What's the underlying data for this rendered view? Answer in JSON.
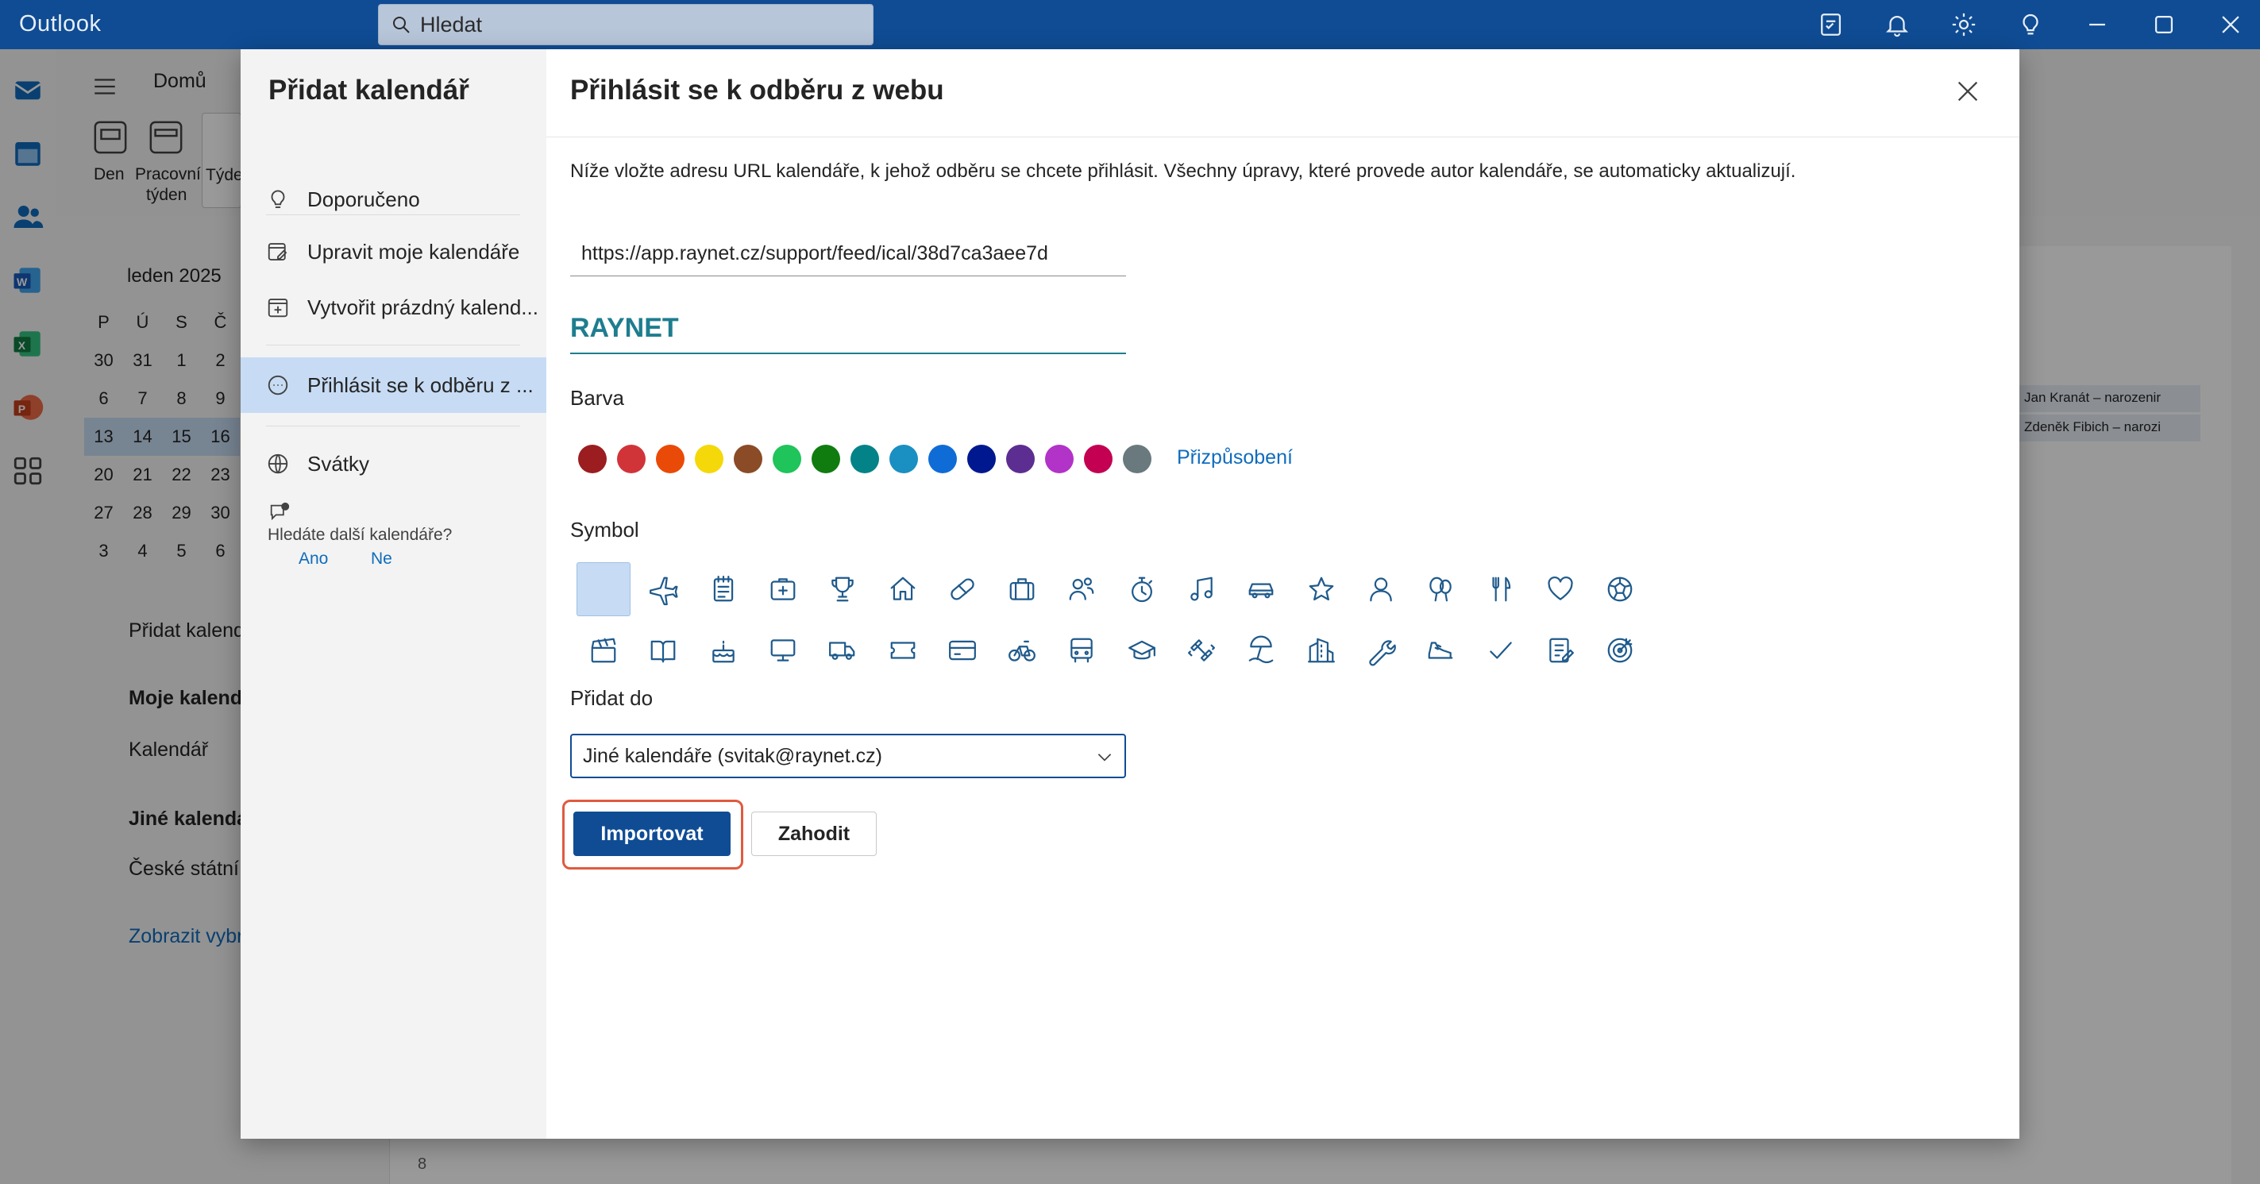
{
  "app": {
    "title": "Outlook"
  },
  "search": {
    "placeholder": "Hledat"
  },
  "ribbon": {
    "home_tab": "Domů",
    "view_day": "Den",
    "view_workweek_line1": "Pracovní",
    "view_workweek_line2": "týden",
    "view_week": "Týde"
  },
  "mini_calendar": {
    "month": "leden 2025",
    "weekdays": [
      "P",
      "Ú",
      "S",
      "Č"
    ],
    "rows": [
      [
        "30",
        "31",
        "1",
        "2"
      ],
      [
        "6",
        "7",
        "8",
        "9"
      ],
      [
        "13",
        "14",
        "15",
        "16"
      ],
      [
        "20",
        "21",
        "22",
        "23"
      ],
      [
        "27",
        "28",
        "29",
        "30"
      ],
      [
        "3",
        "4",
        "5",
        "6"
      ]
    ]
  },
  "left_nav": {
    "add_calendar": "Přidat kalend",
    "my_calendars": "Moje kalend",
    "calendar": "Kalendář",
    "other_calendars": "Jiné kalendá",
    "czech_holidays": "České státní s",
    "show_more": "Zobrazit vybr"
  },
  "calendar_bg": {
    "event1": "Jan Kranát – narozenir",
    "event2": "Zdeněk Fibich – narozi",
    "hour": "8"
  },
  "dialog": {
    "left_title": "Přidat kalendář",
    "nav": [
      {
        "label": "Doporučeno",
        "icon": "lightbulb-icon"
      },
      {
        "label": "Upravit moje kalendáře",
        "icon": "edit-calendar-icon"
      },
      {
        "label": "Vytvořit prázdný kalend...",
        "icon": "add-calendar-icon"
      },
      {
        "label": "Přihlásit se k odběru z ...",
        "icon": "subscribe-icon",
        "active": true
      },
      {
        "label": "Svátky",
        "icon": "globe-icon"
      }
    ],
    "looking_more": "Hledáte další kalendáře?",
    "yes": "Ano",
    "no": "Ne",
    "title": "Přihlásit se k odběru z webu",
    "description": "Níže vložte adresu URL kalendáře, k jehož odběru se chcete přihlásit. Všechny úpravy, které provede autor kalendáře, se automaticky aktualizují.",
    "url_value": "https://app.raynet.cz/support/feed/ical/38d7ca3aee7d",
    "calendar_name": "RAYNET",
    "color_label": "Barva",
    "colors": [
      "#9b1d20",
      "#d13438",
      "#ea4a08",
      "#f5d80a",
      "#8a4b26",
      "#1fc45a",
      "#107c10",
      "#038387",
      "#1a8fc2",
      "#0f6cd6",
      "#00188f",
      "#5c2e91",
      "#b233c7",
      "#c30052",
      "#69797e"
    ],
    "customize": "Přizpůsobení",
    "symbol_label": "Symbol",
    "symbols_row1": [
      "blank",
      "airplane-icon",
      "notepad-icon",
      "first-aid-icon",
      "trophy-icon",
      "home-icon",
      "pill-icon",
      "briefcase-icon",
      "people-icon",
      "stopwatch-icon",
      "music-note-icon",
      "car-icon",
      "star-icon",
      "person-icon",
      "balloon-icon",
      "fork-knife-icon",
      "heart-icon",
      "soccer-ball-icon"
    ],
    "symbols_row2": [
      "movie-clapper-icon",
      "book-icon",
      "cake-icon",
      "monitor-icon",
      "truck-icon",
      "ticket-icon",
      "credit-card-icon",
      "bicycle-icon",
      "bus-icon",
      "graduation-cap-icon",
      "dumbbell-icon",
      "beach-icon",
      "city-icon",
      "wrench-icon",
      "running-shoe-icon",
      "checkmark-icon",
      "task-list-icon",
      "target-icon"
    ],
    "add_to_label": "Přidat do",
    "add_to_value": "Jiné kalendáře (svitak@raynet.cz)",
    "import_button": "Importovat",
    "discard_button": "Zahodit"
  }
}
